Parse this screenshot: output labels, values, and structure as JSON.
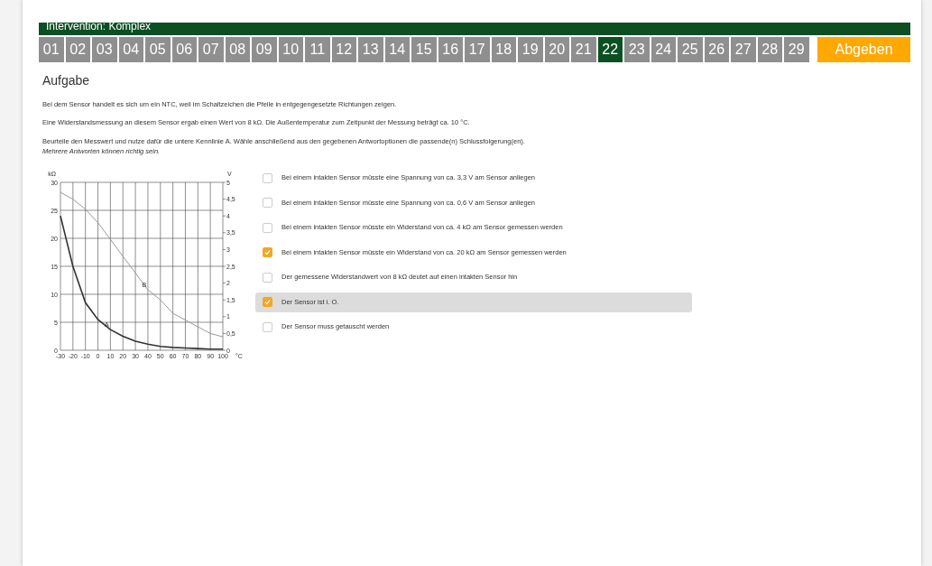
{
  "header": {
    "title": "Intervention: Komplex"
  },
  "questions": [
    {
      "label": "01",
      "selected": false
    },
    {
      "label": "02",
      "selected": false
    },
    {
      "label": "03",
      "selected": false
    },
    {
      "label": "04",
      "selected": false
    },
    {
      "label": "05",
      "selected": false
    },
    {
      "label": "06",
      "selected": false
    },
    {
      "label": "07",
      "selected": false
    },
    {
      "label": "08",
      "selected": false
    },
    {
      "label": "09",
      "selected": false
    },
    {
      "label": "10",
      "selected": false
    },
    {
      "label": "11",
      "selected": false
    },
    {
      "label": "12",
      "selected": false
    },
    {
      "label": "13",
      "selected": false
    },
    {
      "label": "14",
      "selected": false
    },
    {
      "label": "15",
      "selected": false
    },
    {
      "label": "16",
      "selected": false
    },
    {
      "label": "17",
      "selected": false
    },
    {
      "label": "18",
      "selected": false
    },
    {
      "label": "19",
      "selected": false
    },
    {
      "label": "20",
      "selected": false
    },
    {
      "label": "21",
      "selected": false
    },
    {
      "label": "22",
      "selected": true
    },
    {
      "label": "23",
      "selected": false
    },
    {
      "label": "24",
      "selected": false
    },
    {
      "label": "25",
      "selected": false
    },
    {
      "label": "26",
      "selected": false
    },
    {
      "label": "27",
      "selected": false
    },
    {
      "label": "28",
      "selected": false
    },
    {
      "label": "29",
      "selected": false
    }
  ],
  "submit_button": "Abgeben",
  "task": {
    "heading": "Aufgabe",
    "paragraphs": [
      "Bei dem Sensor handelt es sich um ein NTC, weil im Schaltzeichen die Pfeile in entgegengesetzte Richtungen zeigen.",
      "Eine Widerstandsmessung an diesem Sensor ergab einen Wert von 8 kΩ. Die Außentemperatur zum Zeitpunkt der Messung beträgt ca. 10 °C.",
      "Beurteile den Messwert und nutze dafür die untere Kennlinie A. Wähle anschließend aus den gegebenen Antwortoptionen die passende(n) Schlussfolgerung(en)."
    ],
    "hint": "Mehrere Antworten können richtig sein.",
    "chart_data": {
      "type": "line",
      "xlabel": "°C",
      "ylabel": "kΩ",
      "y2label": "V",
      "x": [
        -30,
        -20,
        -10,
        0,
        10,
        20,
        30,
        40,
        50,
        60,
        70,
        80,
        90,
        100
      ],
      "grid": true,
      "xlim": [
        -30,
        100
      ],
      "ylim": [
        0,
        30
      ],
      "y2lim": [
        0,
        5
      ],
      "xticks": [
        -30,
        -20,
        -10,
        0,
        10,
        20,
        30,
        40,
        50,
        60,
        70,
        80,
        90,
        100
      ],
      "yticks": [
        0,
        5,
        10,
        15,
        20,
        25,
        30
      ],
      "y2ticks": [
        {
          "value": 0,
          "label": "0"
        },
        {
          "value": 0.5,
          "label": "0,5"
        },
        {
          "value": 1,
          "label": "1"
        },
        {
          "value": 1.5,
          "label": "1,5"
        },
        {
          "value": 2,
          "label": "2"
        },
        {
          "value": 2.5,
          "label": "2,5"
        },
        {
          "value": 3,
          "label": "3"
        },
        {
          "value": 3.5,
          "label": "3,5"
        },
        {
          "value": 4,
          "label": "4"
        },
        {
          "value": 4.5,
          "label": "4,5"
        },
        {
          "value": 5,
          "label": "5"
        }
      ],
      "series": [
        {
          "name": "A",
          "color": "#333333",
          "values": [
            24,
            15,
            8.5,
            5.5,
            3.7,
            2.5,
            1.6,
            1.1,
            0.7,
            0.5,
            0.4,
            0.3,
            0.2,
            0.2
          ]
        },
        {
          "name": "B",
          "color": "#999999",
          "axis": "y2",
          "values": [
            4.7,
            4.5,
            4.2,
            3.8,
            3.3,
            2.8,
            2.3,
            1.8,
            1.5,
            1.1,
            0.9,
            0.7,
            0.5,
            0.4
          ]
        }
      ]
    }
  },
  "options": [
    {
      "label": "Bei einem intakten Sensor müsste eine Spannung von ca. 3,3 V am Sensor anliegen",
      "checked": false,
      "highlighted": false
    },
    {
      "label": "Bei einem intakten Sensor müsste eine Spannung von ca. 0,6 V am Sensor anliegen",
      "checked": false,
      "highlighted": false
    },
    {
      "label": "Bei einem intakten Sensor müsste ein Widerstand von ca. 4 kΩ am Sensor gemessen werden",
      "checked": false,
      "highlighted": false
    },
    {
      "label": "Bei einem intakten Sensor müsste ein Widerstand von ca. 20 kΩ am Sensor gemessen werden",
      "checked": true,
      "highlighted": false
    },
    {
      "label": "Der gemessene Widerstandwert von 8 kΩ deutet auf einen intakten Sensor hin",
      "checked": false,
      "highlighted": false
    },
    {
      "label": "Der Sensor ist i. O.",
      "checked": true,
      "highlighted": true
    },
    {
      "label": "Der Sensor muss getauscht werden",
      "checked": false,
      "highlighted": false
    }
  ]
}
